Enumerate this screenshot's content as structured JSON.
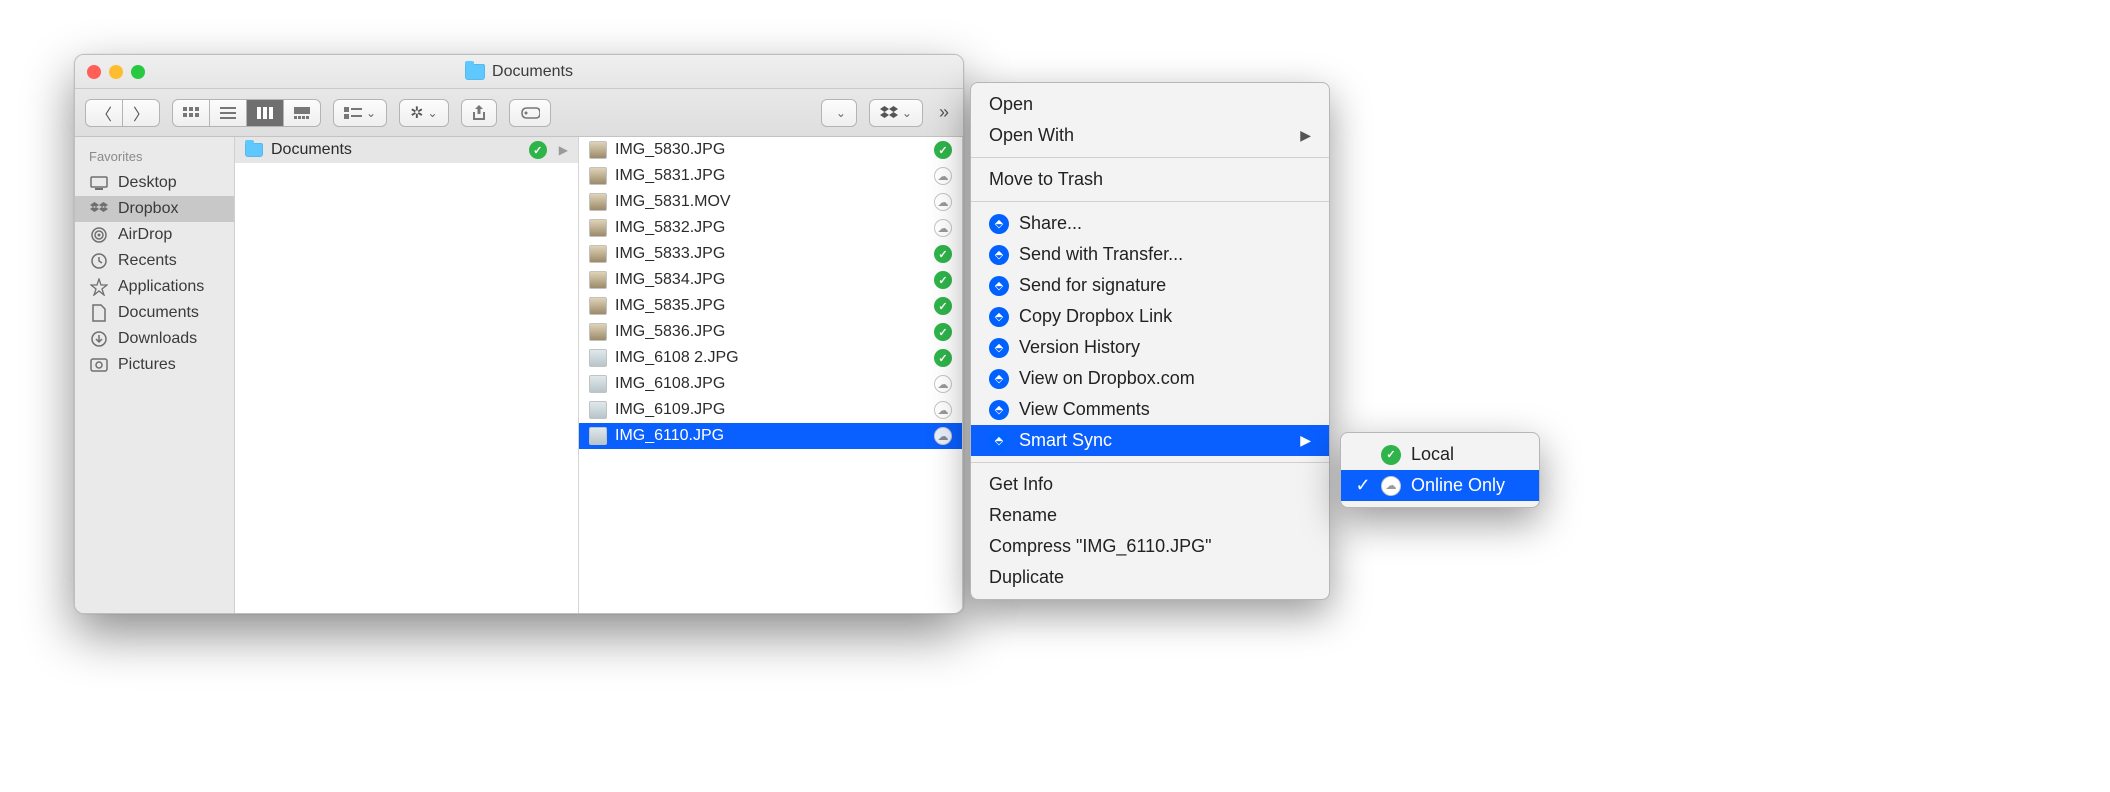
{
  "window": {
    "title": "Documents"
  },
  "sidebar": {
    "header": "Favorites",
    "items": [
      {
        "label": "Desktop"
      },
      {
        "label": "Dropbox"
      },
      {
        "label": "AirDrop"
      },
      {
        "label": "Recents"
      },
      {
        "label": "Applications"
      },
      {
        "label": "Documents"
      },
      {
        "label": "Downloads"
      },
      {
        "label": "Pictures"
      }
    ],
    "selected": "Dropbox"
  },
  "col1": {
    "folder": "Documents"
  },
  "files": [
    {
      "name": "IMG_5830.JPG",
      "status": "green",
      "thumb": "img"
    },
    {
      "name": "IMG_5831.JPG",
      "status": "cloud",
      "thumb": "img"
    },
    {
      "name": "IMG_5831.MOV",
      "status": "cloud",
      "thumb": "img"
    },
    {
      "name": "IMG_5832.JPG",
      "status": "cloud",
      "thumb": "img"
    },
    {
      "name": "IMG_5833.JPG",
      "status": "green",
      "thumb": "img"
    },
    {
      "name": "IMG_5834.JPG",
      "status": "green",
      "thumb": "img"
    },
    {
      "name": "IMG_5835.JPG",
      "status": "green",
      "thumb": "img"
    },
    {
      "name": "IMG_5836.JPG",
      "status": "green",
      "thumb": "img"
    },
    {
      "name": "IMG_6108 2.JPG",
      "status": "green",
      "thumb": "file"
    },
    {
      "name": "IMG_6108.JPG",
      "status": "cloud",
      "thumb": "file"
    },
    {
      "name": "IMG_6109.JPG",
      "status": "cloud",
      "thumb": "file"
    },
    {
      "name": "IMG_6110.JPG",
      "status": "cloud",
      "thumb": "file",
      "selected": true
    }
  ],
  "context": {
    "open": "Open",
    "open_with": "Open With",
    "trash": "Move to Trash",
    "share": "Share...",
    "transfer": "Send with Transfer...",
    "sign": "Send for signature",
    "copy_link": "Copy Dropbox Link",
    "history": "Version History",
    "view_web": "View on Dropbox.com",
    "comments": "View Comments",
    "smart_sync": "Smart Sync",
    "get_info": "Get Info",
    "rename": "Rename",
    "compress": "Compress \"IMG_6110.JPG\"",
    "duplicate": "Duplicate"
  },
  "submenu": {
    "local": "Local",
    "online": "Online Only",
    "selected": "online"
  }
}
